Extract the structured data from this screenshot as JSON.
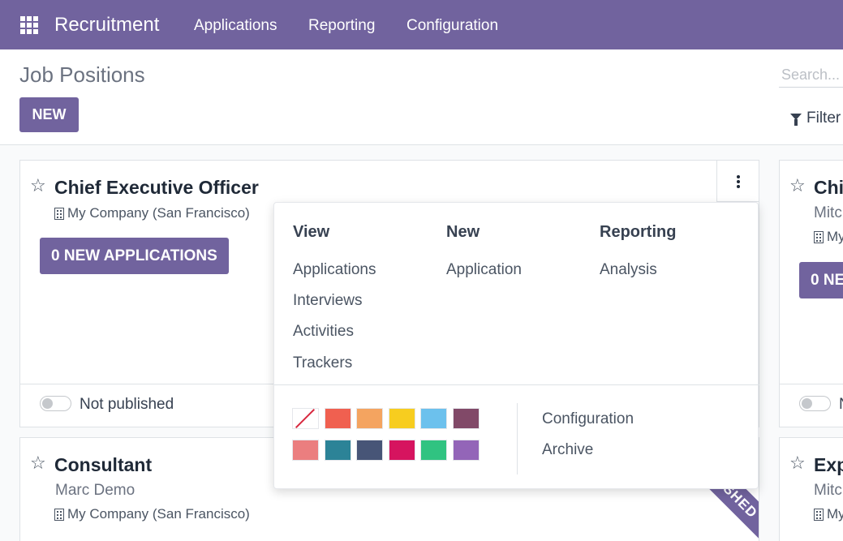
{
  "navbar": {
    "brand": "Recruitment",
    "menu": [
      "Applications",
      "Reporting",
      "Configuration"
    ]
  },
  "control": {
    "title": "Job Positions",
    "new_label": "NEW",
    "search_placeholder": "Search...",
    "filter_label": "Filter"
  },
  "cards": [
    {
      "title": "Chief Executive Officer",
      "company": "My Company (San Francisco)",
      "apps_button": "0 NEW APPLICATIONS",
      "status": "Not published"
    },
    {
      "title": "Consultant",
      "recruiter": "Marc Demo",
      "company": "My Company (San Francisco)",
      "ribbon": "ISHED"
    }
  ],
  "right_cards": [
    {
      "title_fragment": "Chi",
      "recruiter_fragment": "Mitc",
      "company_fragment": "My",
      "apps_fragment": "0 NE",
      "status_fragment": "N"
    },
    {
      "title_fragment": "Exp",
      "recruiter_fragment": "Mitc",
      "company_fragment": "My"
    }
  ],
  "dropdown": {
    "columns": [
      {
        "header": "View",
        "items": [
          "Applications",
          "Interviews",
          "Activities",
          "Trackers"
        ]
      },
      {
        "header": "New",
        "items": [
          "Application"
        ]
      },
      {
        "header": "Reporting",
        "items": [
          "Analysis"
        ]
      }
    ],
    "colors": [
      "none",
      "#f06050",
      "#f4a460",
      "#f7cd1f",
      "#6cc1ed",
      "#814968",
      "#eb7e7f",
      "#2c8397",
      "#475577",
      "#d6145f",
      "#30c381",
      "#9365b8"
    ],
    "actions": [
      "Configuration",
      "Archive"
    ]
  }
}
